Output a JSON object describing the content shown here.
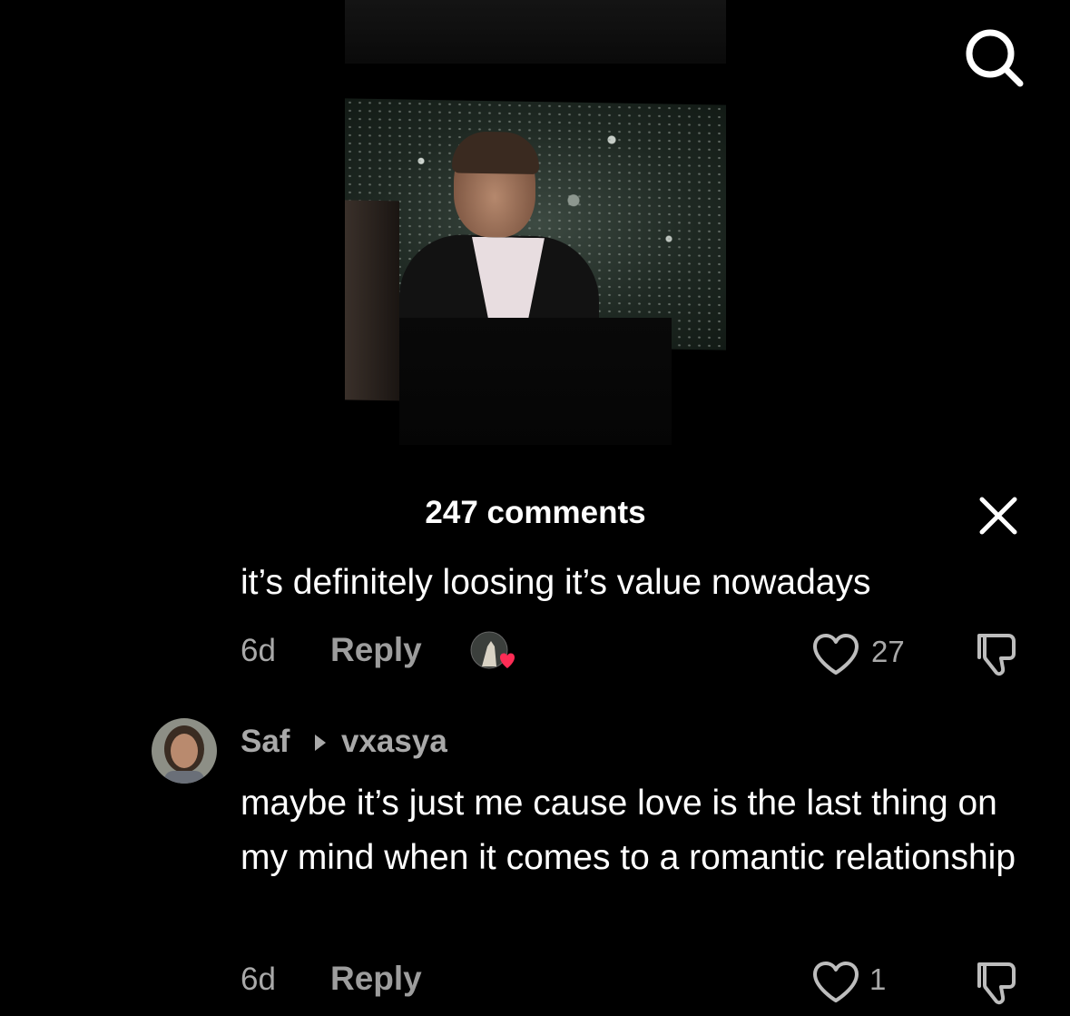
{
  "header": {
    "comments_count": "247 comments"
  },
  "icons": {
    "search": "search-icon",
    "close": "close-icon",
    "heart": "heart-outline-icon",
    "dislike": "thumbs-down-icon"
  },
  "colors": {
    "background": "#000000",
    "text": "#ffffff",
    "muted": "#a9a9a9",
    "liked_heart": "#fe2c55"
  },
  "comments": [
    {
      "text": "it’s definitely loosing it’s value nowadays",
      "time": "6d",
      "reply_label": "Reply",
      "likes": "27",
      "creator_liked": true
    },
    {
      "username": "Saf",
      "reply_to": "vxasya",
      "text": "maybe it’s just me cause love is the last thing on my mind when it comes to a romantic relationship",
      "time": "6d",
      "reply_label": "Reply",
      "likes": "1"
    }
  ]
}
